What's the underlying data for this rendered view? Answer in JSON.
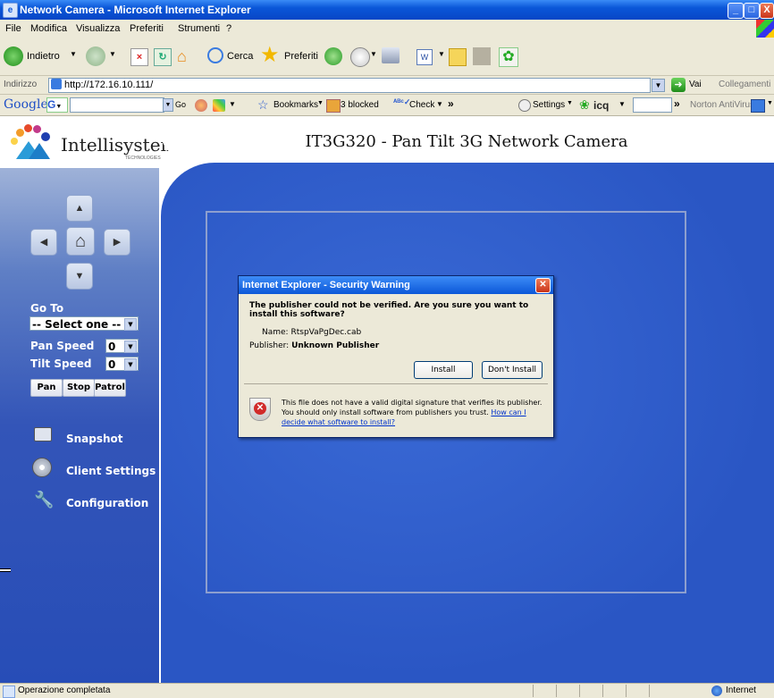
{
  "window": {
    "title": "Network Camera - Microsoft Internet Explorer"
  },
  "menu": [
    "File",
    "Modifica",
    "Visualizza",
    "Preferiti",
    "Strumenti",
    "?"
  ],
  "toolbar": {
    "back_label": "Indietro",
    "search_label": "Cerca",
    "favorites_label": "Preferiti"
  },
  "address": {
    "label": "Indirizzo",
    "url": "http://172.16.10.111/",
    "go_label": "Vai",
    "links_label": "Collegamenti"
  },
  "googlebar": {
    "brand": "Google",
    "g_button": "G",
    "go_label": "Go",
    "bookmarks_label": "Bookmarks",
    "blocked_label": "3 blocked",
    "check_label": "Check",
    "settings_label": "Settings",
    "icq_label": "icq",
    "norton_label": "Norton AntiVirus"
  },
  "page": {
    "logo_text": "Intellisystem",
    "logo_sub": "TECHNOLOGIES",
    "title": "IT3G320 - Pan Tilt 3G Network Camera",
    "goto_label": "Go To",
    "goto_select": "-- Select one --",
    "pan_speed_label": "Pan Speed",
    "pan_speed_value": "0",
    "tilt_speed_label": "Tilt Speed",
    "tilt_speed_value": "0",
    "buttons": {
      "pan": "Pan",
      "stop": "Stop",
      "patrol": "Patrol"
    },
    "menu": [
      {
        "label": "Snapshot",
        "icon": "camera-icon"
      },
      {
        "label": "Client Settings",
        "icon": "disc-icon"
      },
      {
        "label": "Configuration",
        "icon": "tools-icon"
      }
    ]
  },
  "dialog": {
    "title": "Internet Explorer - Security Warning",
    "question": "The publisher could not be verified.  Are you sure you want to install this software?",
    "name_label": "Name:",
    "name_value": "RtspVaPgDec.cab",
    "publisher_label": "Publisher:",
    "publisher_value": "Unknown Publisher",
    "install_label": "Install",
    "dont_install_label": "Don't Install",
    "warning_text": "This file does not have a valid digital signature that verifies its publisher.  You should only install software from publishers you trust.",
    "help_link": "How can I decide what software to install?"
  },
  "status": {
    "text": "Operazione completata",
    "zone": "Internet"
  }
}
